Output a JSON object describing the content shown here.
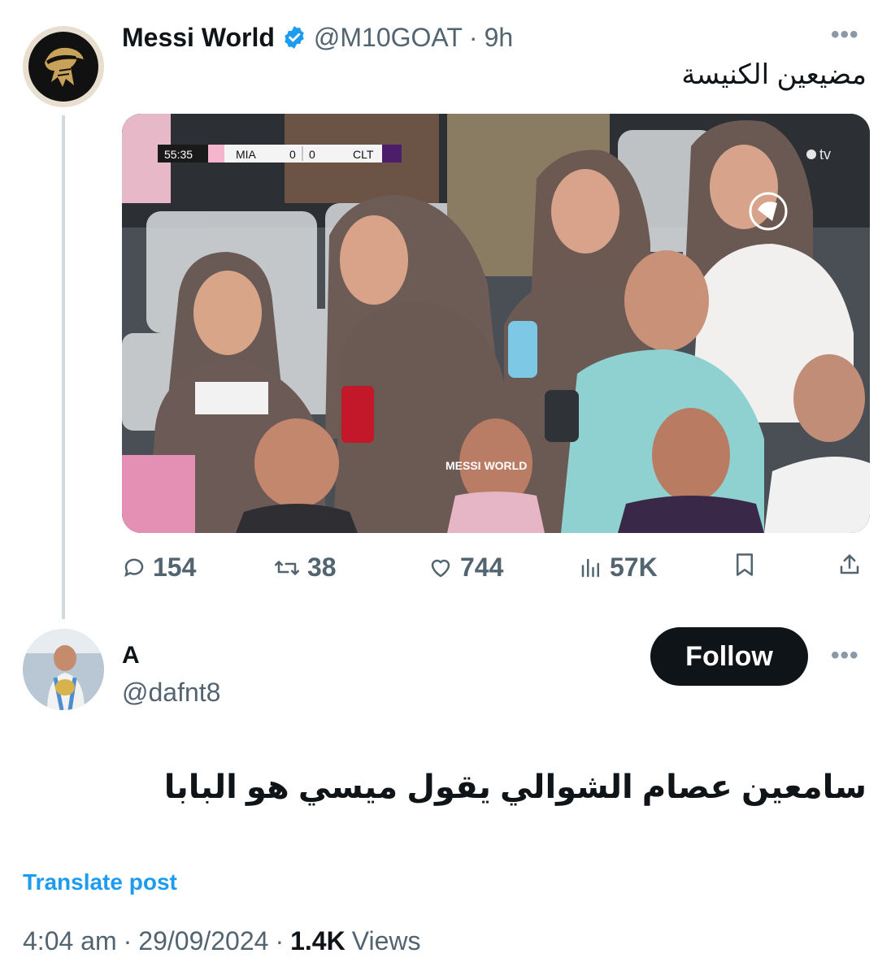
{
  "original_tweet": {
    "author_name": "Messi World",
    "handle": "@M10GOAT",
    "separator": "·",
    "time": "9h",
    "text": "مضيعين الكنيسة",
    "more_icon": "more-horizontal-icon",
    "media": {
      "scoreboard": {
        "clock": "55:35",
        "home": "MIA",
        "home_score": "0",
        "away_score": "0",
        "away": "CLT"
      },
      "broadcaster": "tv",
      "watermark": "MESSI WORLD"
    },
    "actions": {
      "replies": "154",
      "reposts": "38",
      "likes": "744",
      "views": "57K"
    },
    "verified_color": "#1d9bf0"
  },
  "quote_tweet": {
    "author_name": "A",
    "handle": "@dafnt8",
    "follow_label": "Follow",
    "text": "سامعين عصام الشوالي يقول ميسي هو البابا",
    "translate_label": "Translate post",
    "time": "4:04 am",
    "separator": "·",
    "date": "29/09/2024",
    "views_count": "1.4K",
    "views_label": "Views"
  },
  "colors": {
    "text": "#0f1419",
    "muted": "#536471",
    "link": "#1d9bf0",
    "divider": "#cfd9de"
  }
}
